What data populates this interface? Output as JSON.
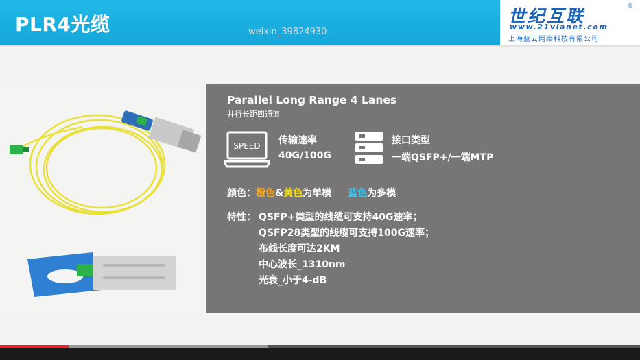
{
  "header": {
    "title": "PLR4光缆",
    "watermark": "weixin_39824930",
    "logo": {
      "main": "世纪互联",
      "registered": "®",
      "url": "www.21vianet.com",
      "company": "上海蓝云网络科技有限公司"
    }
  },
  "panel": {
    "title": "Parallel Long Range 4 Lanes",
    "subtitle": "并行长距四通道",
    "speed": {
      "icon_text": "SPEED",
      "label": "传输速率",
      "value": "40G/100G"
    },
    "interface": {
      "label": "接口类型",
      "value": "一端QSFP+/一端MTP"
    },
    "color_row": {
      "label": "颜色：",
      "orange": "橙色",
      "amp": "&",
      "yellow": "黄色",
      "single": "为单模",
      "blue": "蓝色",
      "multi": "为多模"
    },
    "features": {
      "label": "特性：",
      "lines": [
        "QSFP+类型的线缆可支持40G速率；",
        "QSFP28类型的线缆可支持100G速率；",
        "布线长度可达2KM",
        "中心波长_1310nm",
        "光衰_小于4-dB"
      ]
    }
  },
  "video": {
    "progress": 0.107,
    "buffered": 0.418
  },
  "colors": {
    "header": "#1aaee0",
    "panel": "#787576",
    "orange": "#f5a623",
    "yellow": "#f7e11a",
    "blue": "#3cc7f0",
    "logo": "#1b63b6"
  }
}
